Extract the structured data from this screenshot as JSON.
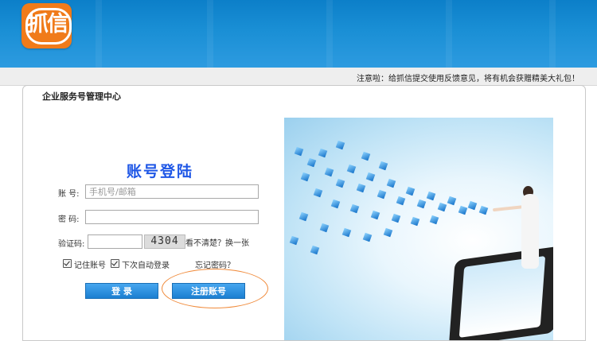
{
  "header": {
    "logo_text": "抓信",
    "notice": "注意啦：给抓信提交使用反馈意见，将有机会获赠精美大礼包！"
  },
  "panel": {
    "title": "企业服务号管理中心"
  },
  "login": {
    "heading": "账号登陆",
    "account_label": "账  号:",
    "account_placeholder": "手机号/邮箱",
    "password_label": "密  码:",
    "captcha_label": "验证码:",
    "captcha_value": "4304",
    "refresh_text": "看不清楚？换一张",
    "remember_label": "记住账号",
    "auto_login_label": "下次自动登录",
    "forgot_label": "忘记密码？",
    "login_button": "登 录",
    "register_button": "注册账号"
  },
  "colors": {
    "header_blue": "#1a8fd5",
    "logo_orange": "#f07b1a",
    "heading_blue": "#1f57e6",
    "button_blue": "#1b7fd1",
    "highlight_oval": "#f08a3a"
  }
}
